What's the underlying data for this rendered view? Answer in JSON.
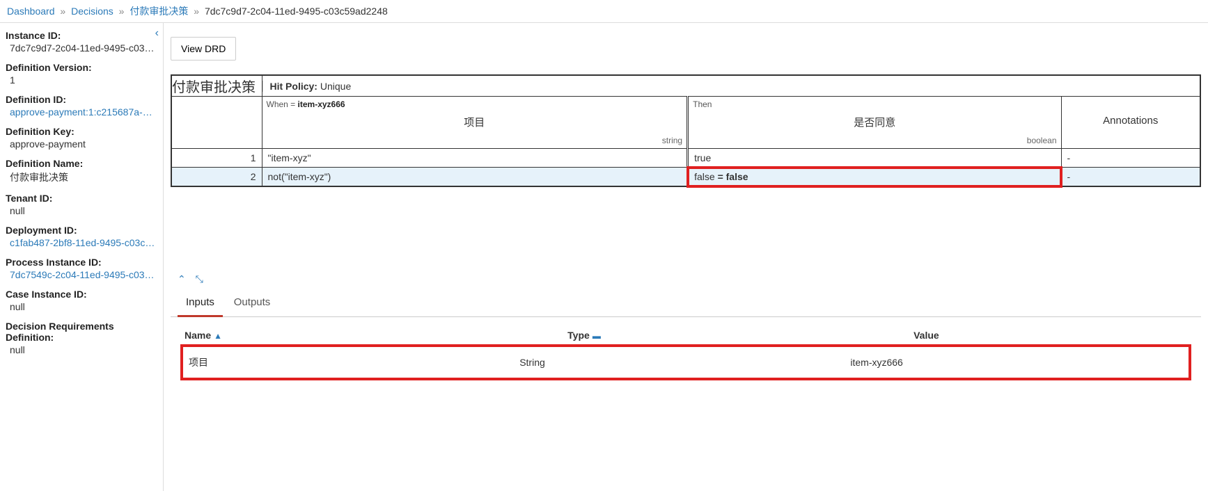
{
  "breadcrumb": {
    "dashboard": "Dashboard",
    "decisions": "Decisions",
    "definition": "付款审批决策",
    "current": "7dc7c9d7-2c04-11ed-9495-c03c59ad2248"
  },
  "sidebar": {
    "instance_id_label": "Instance ID:",
    "instance_id": "7dc7c9d7-2c04-11ed-9495-c03c59...",
    "definition_version_label": "Definition Version:",
    "definition_version": "1",
    "definition_id_label": "Definition ID:",
    "definition_id": "approve-payment:1:c215687a-2bf8-...",
    "definition_key_label": "Definition Key:",
    "definition_key": "approve-payment",
    "definition_name_label": "Definition Name:",
    "definition_name": "付款审批决策",
    "tenant_id_label": "Tenant ID:",
    "tenant_id": "null",
    "deployment_id_label": "Deployment ID:",
    "deployment_id": "c1fab487-2bf8-11ed-9495-c03c59a...",
    "process_instance_id_label": "Process Instance ID:",
    "process_instance_id": "7dc7549c-2c04-11ed-9495-c03c59...",
    "case_instance_id_label": "Case Instance ID:",
    "case_instance_id": "null",
    "drd_label": "Decision Requirements Definition:",
    "drd_value": "null"
  },
  "main": {
    "view_drd": "View DRD",
    "table_title": "付款审批决策",
    "hit_policy_label": "Hit Policy:",
    "hit_policy_value": "Unique",
    "when_prefix": "When = ",
    "when_value": "item-xyz666",
    "input_header": "项目",
    "input_type": "string",
    "then_label": "Then",
    "output_header": "是否同意",
    "output_type": "boolean",
    "ann_header": "Annotations",
    "rules": [
      {
        "idx": "1",
        "in": "\"item-xyz\"",
        "out": "true",
        "ann": "-"
      },
      {
        "idx": "2",
        "in": "not(\"item-xyz\")",
        "out_pre": "false ",
        "out_eq": "= false",
        "ann": "-"
      }
    ]
  },
  "tabs": {
    "inputs": "Inputs",
    "outputs": "Outputs"
  },
  "inputs_table": {
    "col_name": "Name",
    "col_type": "Type",
    "col_value": "Value",
    "rows": [
      {
        "name": "项目",
        "type": "String",
        "value": "item-xyz666"
      }
    ]
  }
}
